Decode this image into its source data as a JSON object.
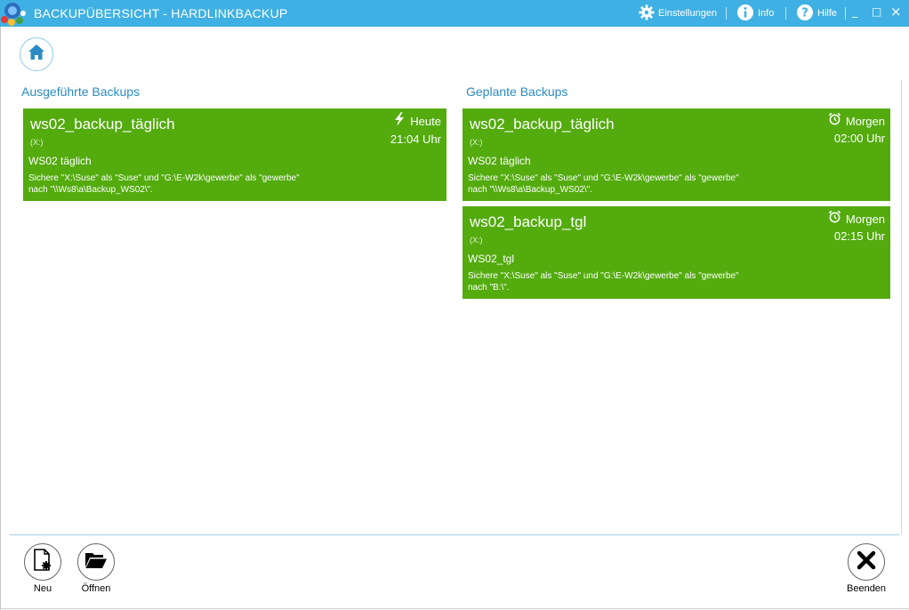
{
  "window": {
    "title": "BACKUPÜBERSICHT - HARDLINKBACKUP",
    "settings_label": "Einstellungen",
    "info_label": "Info",
    "help_label": "Hilfe",
    "minimize_glyph": "_",
    "maximize_glyph": "□",
    "close_glyph": "×"
  },
  "sections": {
    "executed_title": "Ausgeführte Backups",
    "planned_title": "Geplante Backups"
  },
  "executed": [
    {
      "name": "ws02_backup_täglich",
      "drive": "(X:)",
      "description": "WS02 täglich",
      "detail_line1": "Sichere \"X:\\Suse\" als \"Suse\" und \"G:\\E-W2k\\gewerbe\" als \"gewerbe\"",
      "detail_line2": "nach \"\\\\Ws8\\a\\Backup_WS02\\\".",
      "day": "Heute",
      "time": "21:04 Uhr"
    }
  ],
  "planned": [
    {
      "name": "ws02_backup_täglich",
      "drive": "(X:)",
      "description": "WS02 täglich",
      "detail_line1": "Sichere \"X:\\Suse\" als \"Suse\" und \"G:\\E-W2k\\gewerbe\" als \"gewerbe\"",
      "detail_line2": "nach \"\\\\Ws8\\a\\Backup_WS02\\\".",
      "day": "Morgen",
      "time": "02:00 Uhr"
    },
    {
      "name": "ws02_backup_tgl",
      "drive": "(X:)",
      "description": "WS02_tgl",
      "detail_line1": "Sichere \"X:\\Suse\" als \"Suse\" und \"G:\\E-W2k\\gewerbe\" als \"gewerbe\"",
      "detail_line2": "nach \"B:\\\".",
      "day": "Morgen",
      "time": "02:15 Uhr"
    }
  ],
  "toolbar": {
    "new_label": "Neu",
    "open_label": "Öffnen",
    "quit_label": "Beenden"
  },
  "colors": {
    "titlebar": "#3fb0e3",
    "card": "#53ab0e",
    "section_title": "#2a8bc4"
  }
}
